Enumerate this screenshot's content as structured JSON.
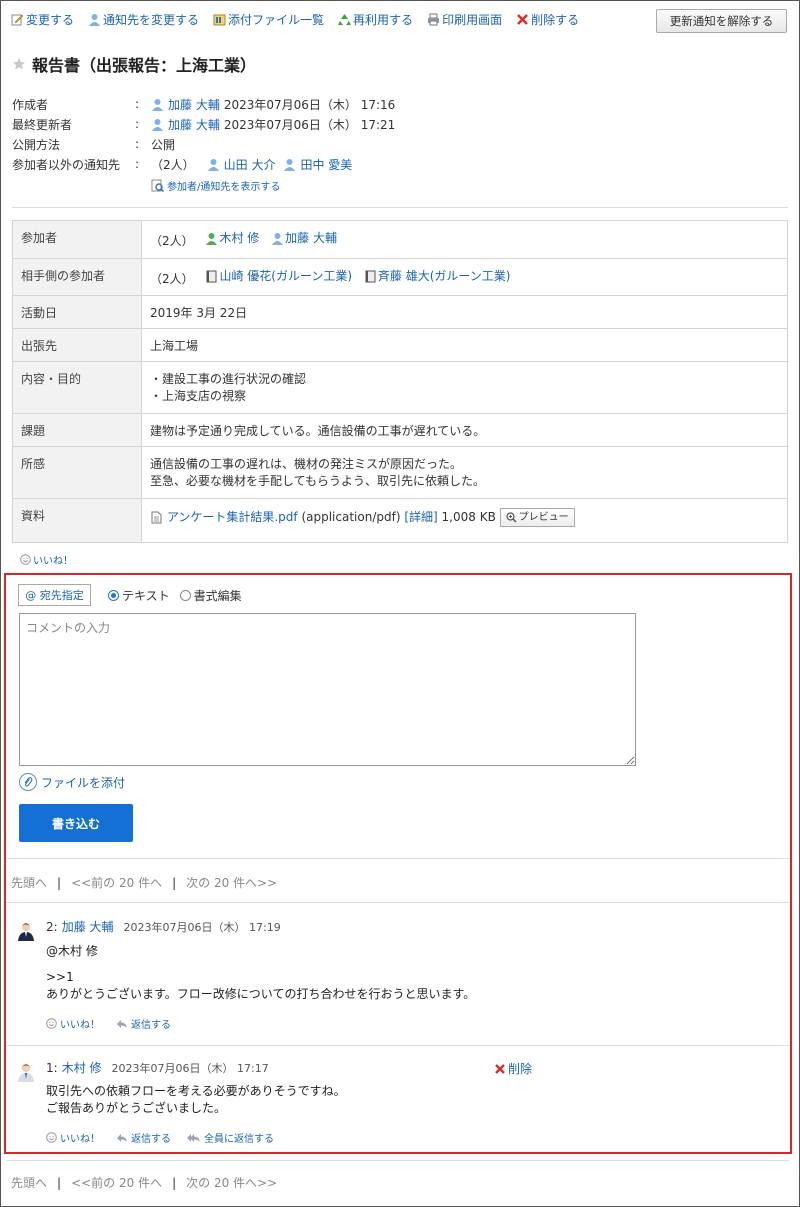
{
  "toolbar": {
    "edit": "変更する",
    "change_notify": "通知先を変更する",
    "attachments": "添付ファイル一覧",
    "reuse": "再利用する",
    "print": "印刷用画面",
    "delete": "削除する",
    "unsubscribe": "更新通知を解除する"
  },
  "report": {
    "title": "報告書（出張報告：上海工業）"
  },
  "meta": {
    "creator_label": "作成者",
    "creator_name": "加藤 大輔",
    "creator_time": "2023年07月06日（木） 17:16",
    "updater_label": "最終更新者",
    "updater_name": "加藤 大輔",
    "updater_time": "2023年07月06日（木） 17:21",
    "visibility_label": "公開方法",
    "visibility_value": "公開",
    "notify_label": "参加者以外の通知先",
    "notify_count": "（2人）",
    "notify_user1": "山田 大介",
    "notify_user2": "田中 愛美",
    "show_link": "参加者/通知先を表示する",
    "colon": ":"
  },
  "details": {
    "participants_label": "参加者",
    "participants_count": "（2人）",
    "participant1": "木村 修",
    "participant2": "加藤 大輔",
    "partner_label": "相手側の参加者",
    "partner_count": "（2人）",
    "partner1": "山崎 優花(ガルーン工業)",
    "partner2": "斉藤 雄大(ガルーン工業)",
    "date_label": "活動日",
    "date_value": "2019年 3月 22日",
    "place_label": "出張先",
    "place_value": "上海工場",
    "purpose_label": "内容・目的",
    "purpose_line1": "・建設工事の進行状況の確認",
    "purpose_line2": "・上海支店の視察",
    "issue_label": "課題",
    "issue_value": "建物は予定通り完成している。通信設備の工事が遅れている。",
    "impression_label": "所感",
    "impression_line1": "通信設備の工事の遅れは、機材の発注ミスが原因だった。",
    "impression_line2": "至急、必要な機材を手配してもらうよう、取引先に依頼した。",
    "material_label": "資料",
    "file_name": "アンケート集計結果.pdf",
    "file_type": "(application/pdf)",
    "file_detail": "[詳細]",
    "file_size": "1,008 KB",
    "preview": "プレビュー"
  },
  "like": "いいね！",
  "comment_form": {
    "mention": "@ 宛先指定",
    "text_mode": "テキスト",
    "rich_mode": "書式編集",
    "placeholder": "コメントの入力",
    "attach": "ファイルを添付",
    "submit": "書き込む"
  },
  "pager": {
    "first": "先頭へ",
    "prev": "<<前の 20 件へ",
    "next": "次の 20 件へ>>",
    "sep": "|"
  },
  "comments": [
    {
      "num": "2:",
      "author": "加藤 大輔",
      "time": "2023年07月06日（木） 17:19",
      "mention": "@木村 修",
      "reply_ref": ">>1",
      "text": "ありがとうございます。フロー改修についての打ち合わせを行おうと思います。",
      "like": "いいね！",
      "reply": "返信する"
    },
    {
      "num": "1:",
      "author": "木村 修",
      "time": "2023年07月06日（木） 17:17",
      "delete": "削除",
      "line1": "取引先への依頼フローを考える必要がありそうですね。",
      "line2": "ご報告ありがとうございました。",
      "like": "いいね！",
      "reply": "返信する",
      "reply_all": "全員に返信する"
    }
  ],
  "colors": {
    "link": "#1a63b3",
    "highlight_border": "#d9262a",
    "primary_button": "#1570d6"
  }
}
